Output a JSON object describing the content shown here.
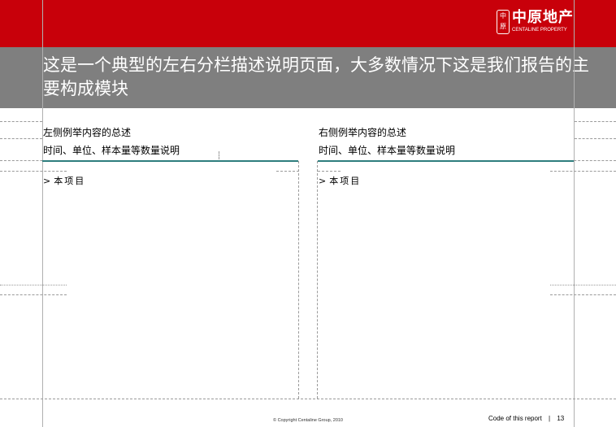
{
  "header": {
    "title": "这是一个典型的左右分栏描述说明页面，大多数情况下这是我们报告的主要构成模块",
    "logo": {
      "seal_text": "中原",
      "name_cn": "中原地产",
      "name_en": "CENTALINE PROPERTY"
    },
    "colors": {
      "brand_red": "#c8000a",
      "title_gray": "#7f7f7f",
      "accent_teal": "#2e7d7d"
    }
  },
  "columns": [
    {
      "summary": "左侧例举内容的总述",
      "subtitle": "时间、单位、样本量等数量说明",
      "bullet_marker": ">",
      "bullet": "本项目"
    },
    {
      "summary": "右侧例举内容的总述",
      "subtitle": "时间、单位、样本量等数量说明",
      "bullet_marker": ">",
      "bullet": "本项目"
    }
  ],
  "footer": {
    "copyright": "© Copyright  Centaline  Group,  2010",
    "report_label": "Code of this report",
    "separator": "|",
    "page_number": "13"
  }
}
